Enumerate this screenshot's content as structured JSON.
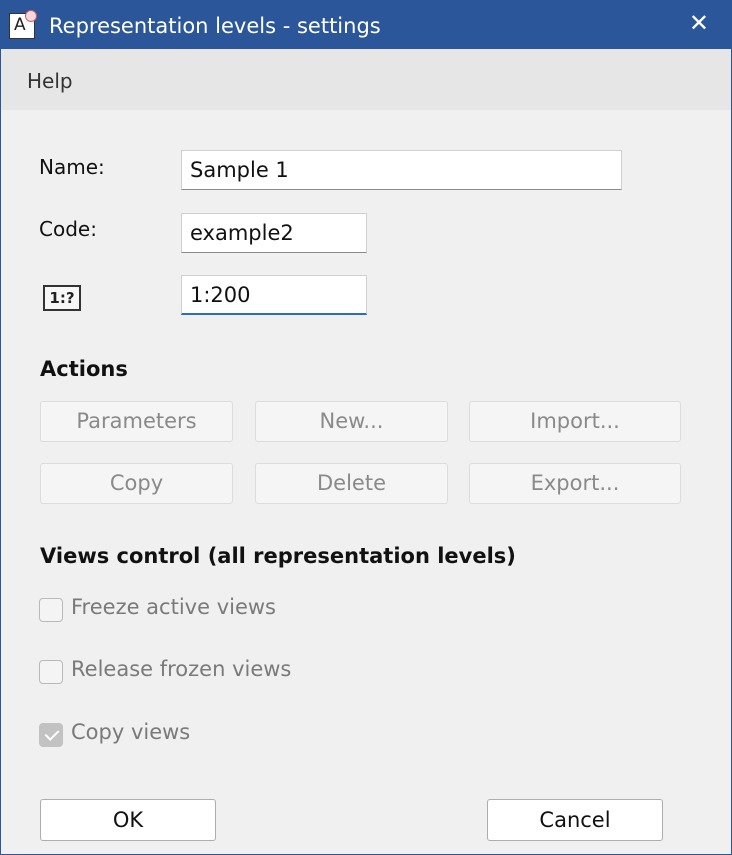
{
  "window": {
    "title": "Representation levels - settings",
    "close_glyph": "✕",
    "app_icon": "A"
  },
  "menu": {
    "help": "Help"
  },
  "form": {
    "name_label": "Name:",
    "name_value": "Sample 1",
    "code_label": "Code:",
    "code_value": "example2",
    "scale_icon": "1:?",
    "scale_value": "1:200"
  },
  "actions": {
    "heading": "Actions",
    "parameters": "Parameters",
    "new": "New...",
    "import": "Import...",
    "copy": "Copy",
    "delete": "Delete",
    "export": "Export..."
  },
  "views_control": {
    "heading": "Views control (all representation levels)",
    "freeze": {
      "label": "Freeze active views",
      "checked": false
    },
    "release": {
      "label": "Release frozen views",
      "checked": false
    },
    "copy": {
      "label": "Copy views",
      "checked": true
    }
  },
  "footer": {
    "ok": "OK",
    "cancel": "Cancel"
  },
  "colors": {
    "titlebar": "#2b579a",
    "background": "#f0f0f0",
    "focus": "#2b6cc4"
  }
}
